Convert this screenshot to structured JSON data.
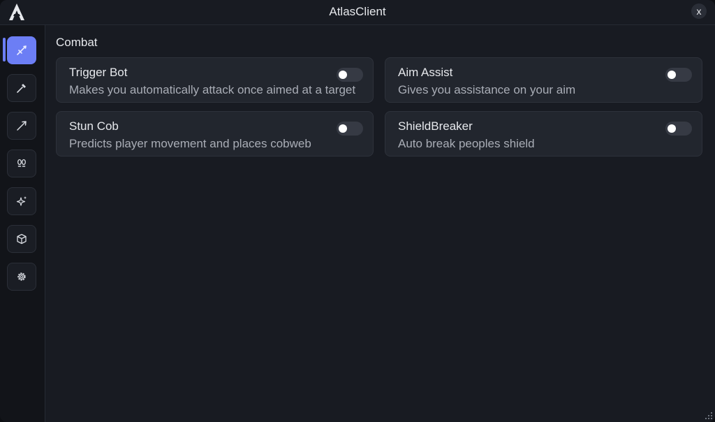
{
  "window": {
    "title": "AtlasClient",
    "close_label": "x",
    "logo_icon": "atlas-logo-icon"
  },
  "sidebar": {
    "items": [
      {
        "id": "combat",
        "icon": "sword-icon",
        "active": true
      },
      {
        "id": "tools",
        "icon": "pickaxe-icon",
        "active": false
      },
      {
        "id": "ranged",
        "icon": "arrow-icon",
        "active": false
      },
      {
        "id": "movement",
        "icon": "footsteps-icon",
        "active": false
      },
      {
        "id": "render",
        "icon": "sparkles-icon",
        "active": false
      },
      {
        "id": "world",
        "icon": "cube-icon",
        "active": false
      },
      {
        "id": "settings",
        "icon": "gear-icon",
        "active": false
      }
    ]
  },
  "main": {
    "section_title": "Combat",
    "modules": [
      {
        "title": "Trigger Bot",
        "description": "Makes you automatically attack once aimed at a target",
        "enabled": false
      },
      {
        "title": "Aim Assist",
        "description": "Gives you assistance on your aim",
        "enabled": false
      },
      {
        "title": "Stun Cob",
        "description": "Predicts player movement and places cobweb",
        "enabled": false
      },
      {
        "title": "ShieldBreaker",
        "description": "Auto break peoples shield",
        "enabled": false
      }
    ]
  },
  "colors": {
    "accent": "#6c7ef5",
    "background": "#181b22",
    "card": "#22262e",
    "text": "#e6e8ec",
    "muted_text": "#a9adb6"
  }
}
